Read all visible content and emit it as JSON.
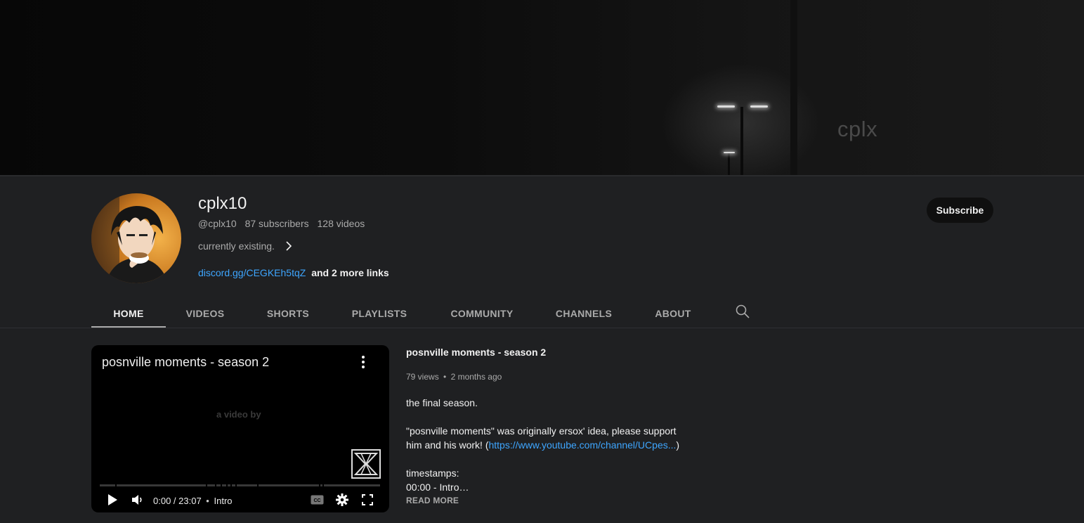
{
  "banner": {
    "text": "cplx"
  },
  "channel": {
    "name": "cplx10",
    "handle": "@cplx10",
    "subscribers": "87 subscribers",
    "videos": "128 videos",
    "description": "currently existing.",
    "link_text": "discord.gg/CEGKEh5tqZ",
    "more_links": "and 2 more links",
    "subscribe_label": "Subscribe"
  },
  "tabs": [
    {
      "label": "HOME",
      "active": true
    },
    {
      "label": "VIDEOS"
    },
    {
      "label": "SHORTS"
    },
    {
      "label": "PLAYLISTS"
    },
    {
      "label": "COMMUNITY"
    },
    {
      "label": "CHANNELS"
    },
    {
      "label": "ABOUT"
    }
  ],
  "icons": {
    "search": "search-icon",
    "chevron": "chevron-right-icon",
    "menu": "more-vert-icon",
    "play": "play-icon",
    "volume": "volume-icon",
    "cc": "captions-icon",
    "settings": "gear-icon",
    "fullscreen": "fullscreen-icon"
  },
  "player": {
    "title": "posnville moments - season 2",
    "watermark": "a video by",
    "time": "0:00 / 23:07",
    "chapter": "Intro",
    "progress": 0
  },
  "video": {
    "title": "posnville moments - season 2",
    "views": "79 views",
    "age": "2 months ago",
    "desc_line1": "the final season.",
    "desc_line2": "\"posnville moments\" was originally ersox' idea, please support",
    "desc_line3_pre": "him and his work! (",
    "desc_link": "https://www.youtube.com/channel/UCpes...",
    "desc_line3_post": ")",
    "desc_line4": "timestamps:",
    "desc_line5": "00:00 - Intro…",
    "read_more": "READ MORE"
  },
  "colors": {
    "background": "#1f2022",
    "link": "#3ea6ff",
    "secondary_text": "#aaaaaa"
  }
}
